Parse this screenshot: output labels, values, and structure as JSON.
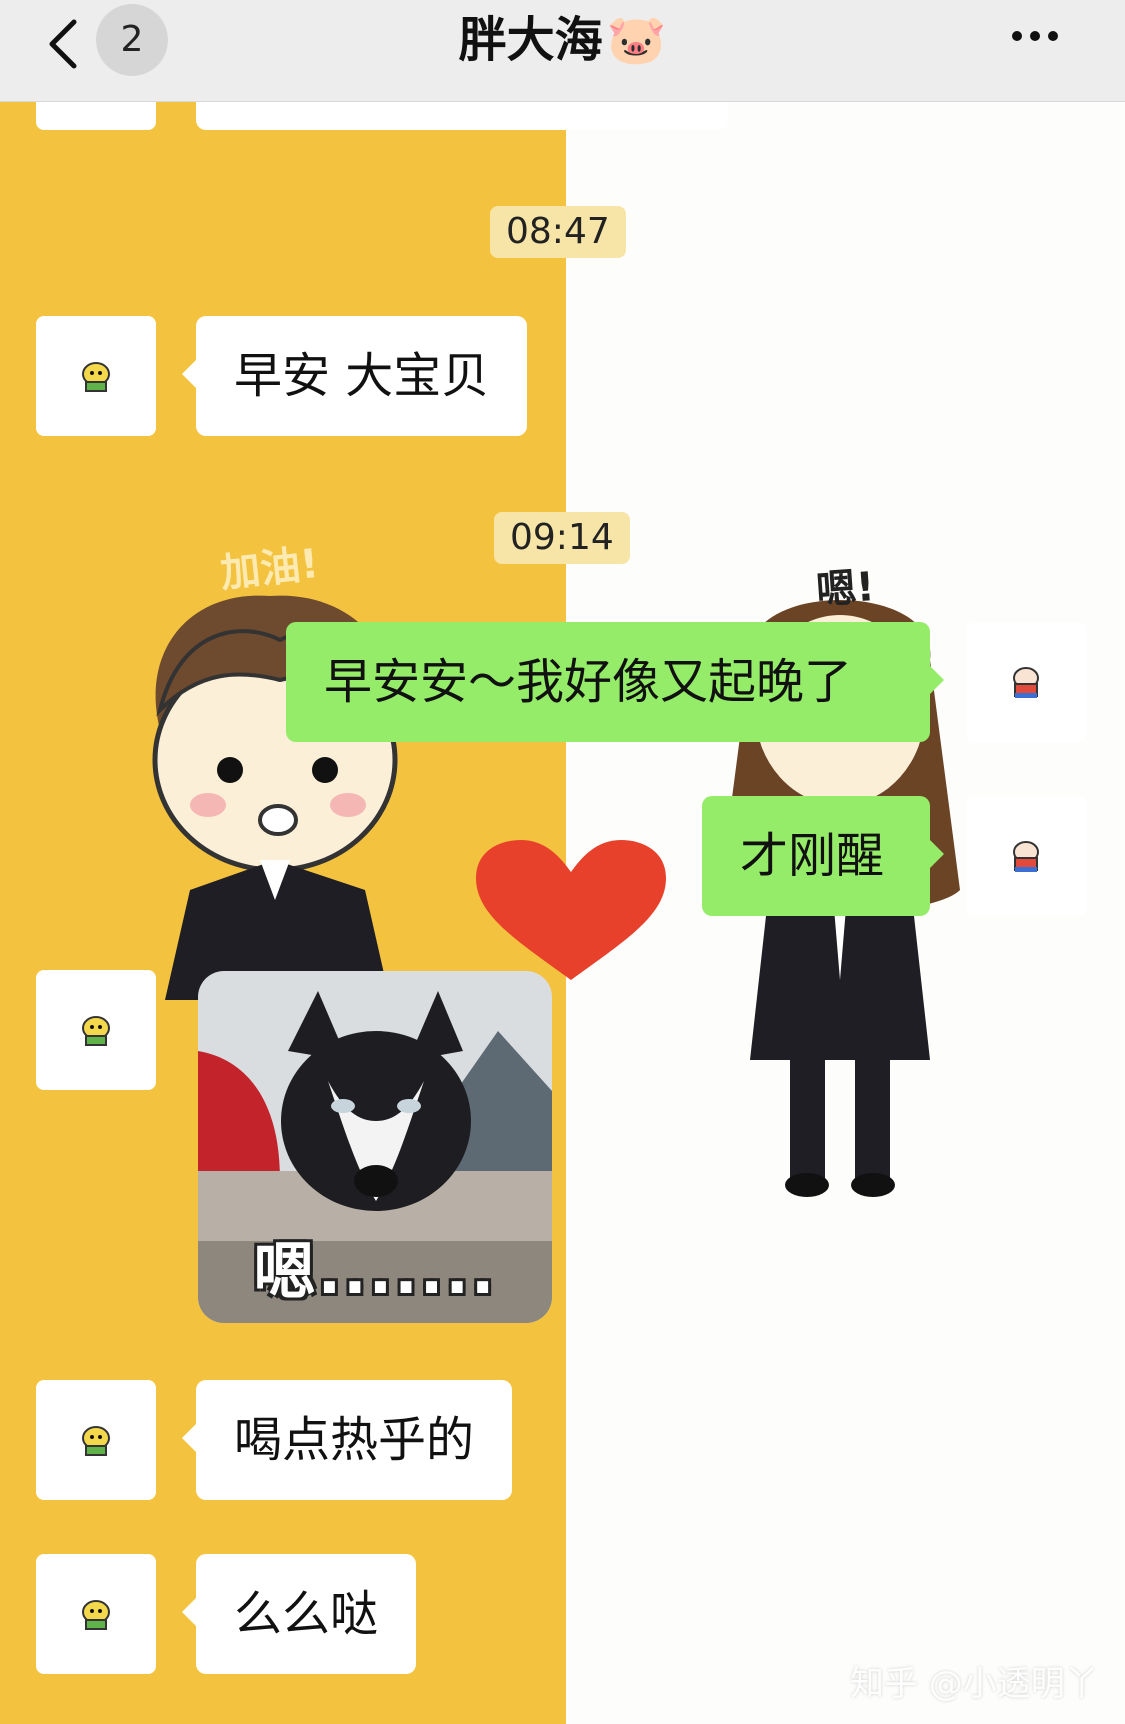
{
  "header": {
    "title": "胖大海",
    "title_emoji": "🐷",
    "unread_count": "2",
    "back_icon": "chevron-left-icon",
    "more_icon": "ellipsis-icon"
  },
  "decorations": {
    "left_text": "加油!",
    "right_text": "嗯!"
  },
  "messages": {
    "time_1": "08:47",
    "m1": "早安 大宝贝",
    "time_2": "09:14",
    "m2": "早安安～我好像又起晚了",
    "m3": "才刚醒",
    "sticker_caption": "嗯.......",
    "m4": "喝点热乎的",
    "m5": "么么哒"
  },
  "watermark": "知乎 @小透明丫",
  "colors": {
    "wallpaper_left": "#F3C340",
    "bubble_out": "#95EC69",
    "bubble_in": "#FFFFFF",
    "heart": "#E8412B"
  }
}
